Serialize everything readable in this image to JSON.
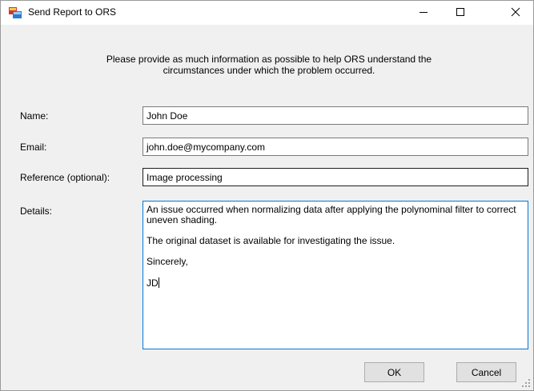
{
  "window": {
    "title": "Send Report to ORS",
    "icon": "app-icon",
    "controls": {
      "minimize_icon": "minimize-icon",
      "maximize_icon": "maximize-icon",
      "close_icon": "close-icon"
    }
  },
  "intro": {
    "line1": "Please provide as much information as possible to help ORS understand the",
    "line2": "circumstances under which the problem occurred."
  },
  "form": {
    "name": {
      "label": "Name:",
      "value": "John Doe"
    },
    "email": {
      "label": "Email:",
      "value": "john.doe@mycompany.com"
    },
    "reference": {
      "label": "Reference (optional):",
      "value": "Image processing"
    },
    "details": {
      "label": "Details:",
      "paragraphs": [
        "An issue occurred when normalizing data after applying the polynominal filter to correct uneven shading.",
        "The original dataset is available for investigating the issue.",
        "Sincerely,",
        "JD"
      ]
    }
  },
  "buttons": {
    "ok": "OK",
    "cancel": "Cancel"
  },
  "colors": {
    "dialog_bg": "#f0f0f0",
    "focus_border": "#0078d7",
    "button_bg": "#e1e1e1"
  }
}
